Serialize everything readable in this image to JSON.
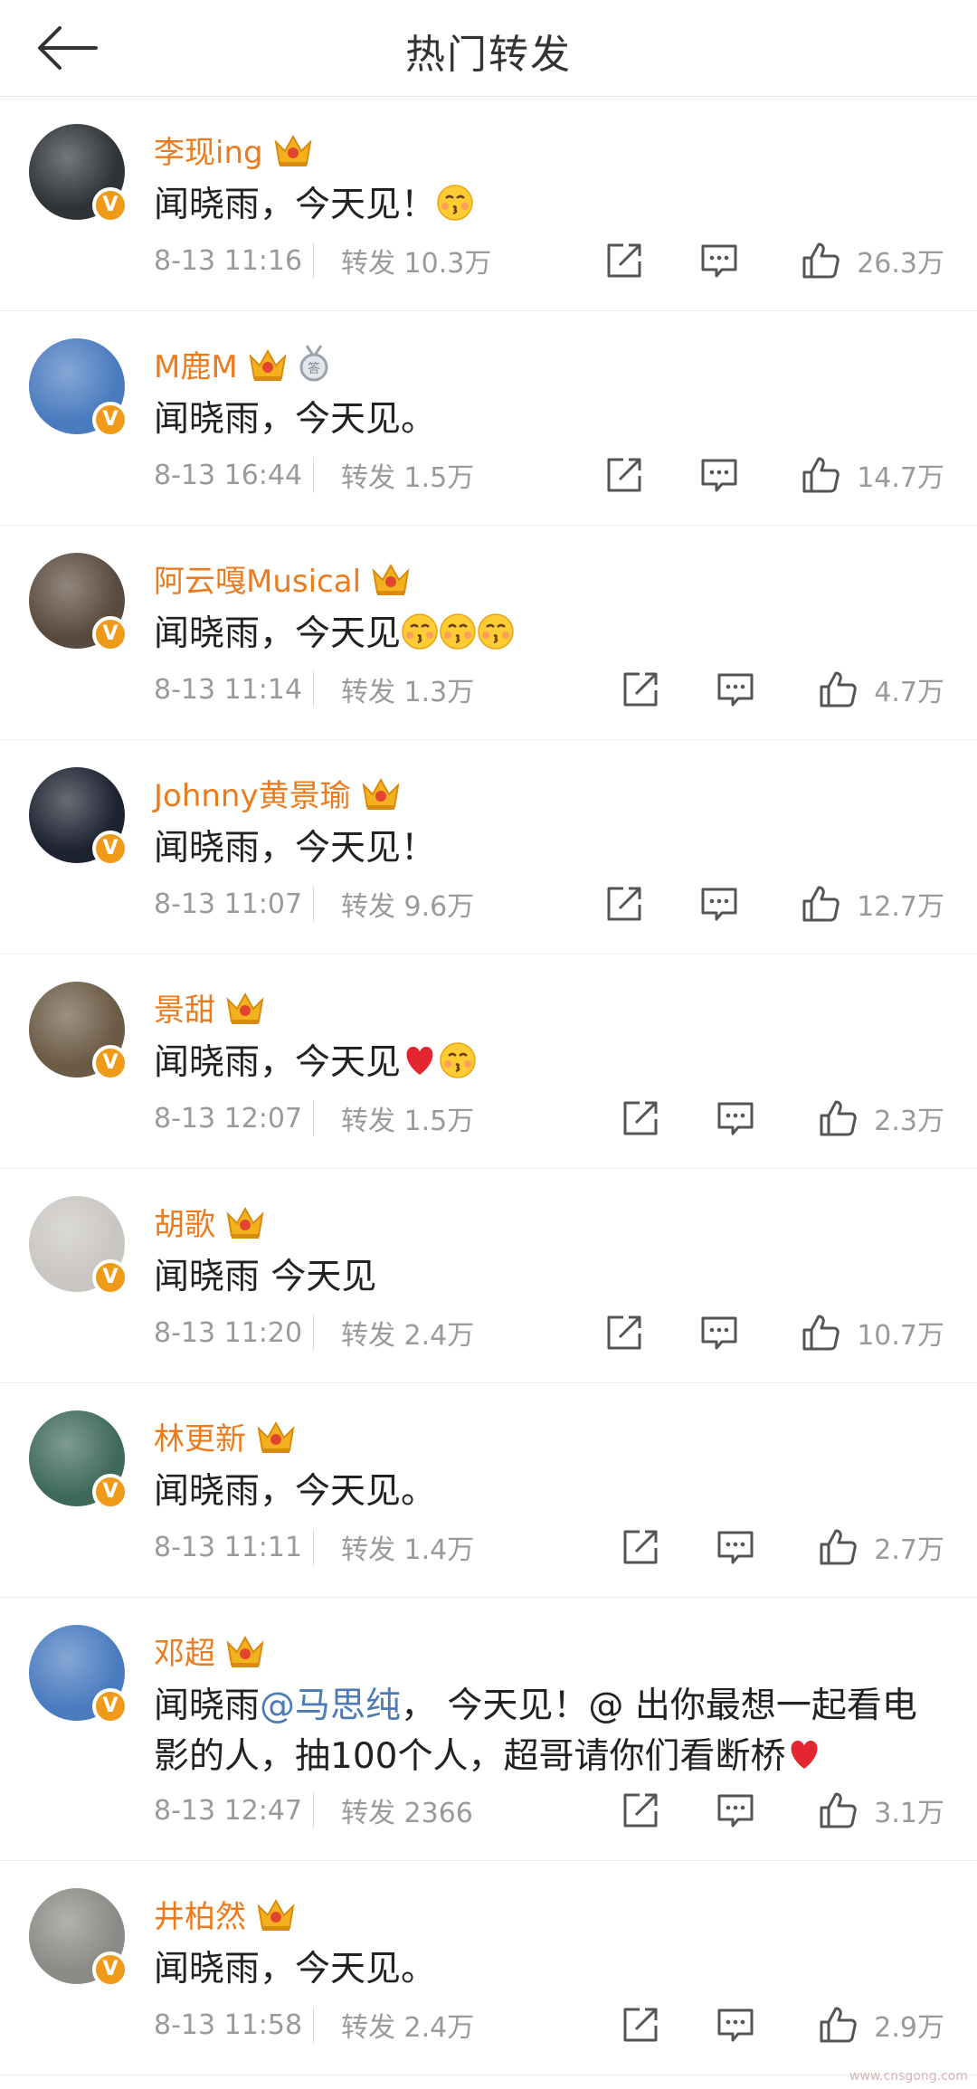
{
  "header": {
    "title": "热门转发",
    "back_icon": "arrow-left-icon"
  },
  "accent": {
    "username": "#eb7b1c",
    "mention": "#4d7bb3",
    "verified": "#f09a1a"
  },
  "posts": [
    {
      "user": "李现ing",
      "text": "闻晓雨，今天见！",
      "emoji": [
        "kiss"
      ],
      "time": "8-13 11:16",
      "repost_label": "转发",
      "reposts": "10.3万",
      "likes": "26.3万",
      "avatar_color": "#2e3338"
    },
    {
      "user": "M鹿M",
      "text": "闻晓雨，今天见。",
      "emoji": [],
      "time": "8-13 16:44",
      "repost_label": "转发",
      "reposts": "1.5万",
      "likes": "14.7万",
      "avatar_color": "#4a7bbf",
      "medal": true
    },
    {
      "user": "阿云嘎Musical",
      "text": "闻晓雨，今天见",
      "emoji": [
        "kiss",
        "kiss",
        "kiss"
      ],
      "time": "8-13 11:14",
      "repost_label": "转发",
      "reposts": "1.3万",
      "likes": "4.7万",
      "avatar_color": "#5a4a3e"
    },
    {
      "user": "Johnny黄景瑜",
      "text": "闻晓雨，今天见！",
      "emoji": [],
      "time": "8-13 11:07",
      "repost_label": "转发",
      "reposts": "9.6万",
      "likes": "12.7万",
      "avatar_color": "#1d2230"
    },
    {
      "user": "景甜",
      "text": "闻晓雨，今天见",
      "emoji": [
        "heart",
        "kiss"
      ],
      "time": "8-13 12:07",
      "repost_label": "转发",
      "reposts": "1.5万",
      "likes": "2.3万",
      "avatar_color": "#6b5a44"
    },
    {
      "user": "胡歌",
      "text": "闻晓雨 今天见",
      "emoji": [],
      "time": "8-13 11:20",
      "repost_label": "转发",
      "reposts": "2.4万",
      "likes": "10.7万",
      "avatar_color": "#c9c6c2"
    },
    {
      "user": "林更新",
      "text": "闻晓雨，今天见。",
      "emoji": [],
      "time": "8-13 11:11",
      "repost_label": "转发",
      "reposts": "1.4万",
      "likes": "2.7万",
      "avatar_color": "#3f6a5a"
    },
    {
      "user": "邓超",
      "text_before": "闻晓雨",
      "mention": "@马思纯",
      "text": "， 今天见！@ 出你最想一起看电影的人，抽100个人，超哥请你们看断桥",
      "emoji": [
        "heart"
      ],
      "time": "8-13 12:47",
      "repost_label": "转发",
      "reposts": "2366",
      "likes": "3.1万",
      "avatar_color": "#4a7bbf"
    },
    {
      "user": "井柏然",
      "text": "闻晓雨，今天见。",
      "emoji": [],
      "time": "8-13 11:58",
      "repost_label": "转发",
      "reposts": "2.4万",
      "likes": "2.9万",
      "avatar_color": "#8a8a86"
    }
  ],
  "watermark": "www.cnsgong.com"
}
